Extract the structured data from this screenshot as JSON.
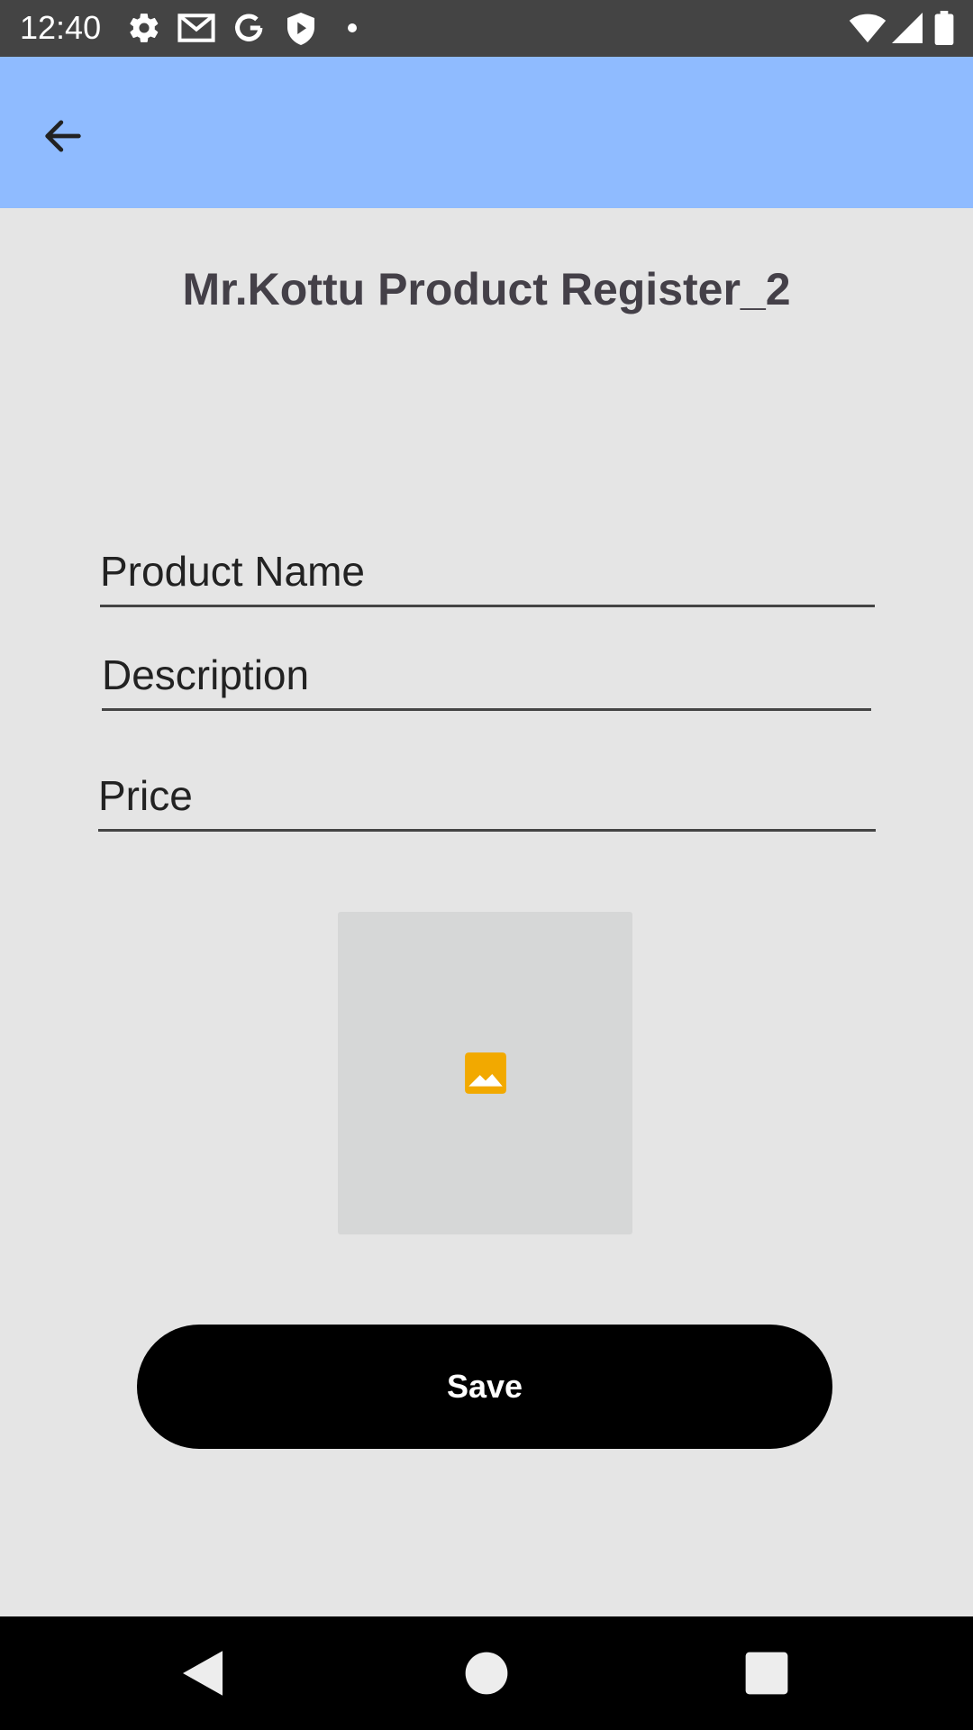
{
  "status_bar": {
    "time": "12:40",
    "left_icons": [
      "gear-icon",
      "gmail-icon",
      "google-icon",
      "shield-icon",
      "dot-icon"
    ],
    "right_icons": [
      "wifi-icon",
      "signal-icon",
      "battery-icon"
    ]
  },
  "app_bar": {
    "background": "#8fbbff",
    "back_icon": "arrow-back-icon"
  },
  "page": {
    "title": "Mr.Kottu Product Register_2"
  },
  "form": {
    "product_name": {
      "placeholder": "Product Name",
      "value": ""
    },
    "description": {
      "placeholder": "Description",
      "value": ""
    },
    "price": {
      "placeholder": "Price",
      "value": ""
    },
    "image_picker": {
      "icon": "image-placeholder-icon",
      "icon_color": "#f2a900"
    },
    "save_label": "Save"
  },
  "nav_bar": {
    "buttons": [
      "back-triangle-icon",
      "home-circle-icon",
      "recents-square-icon"
    ]
  }
}
